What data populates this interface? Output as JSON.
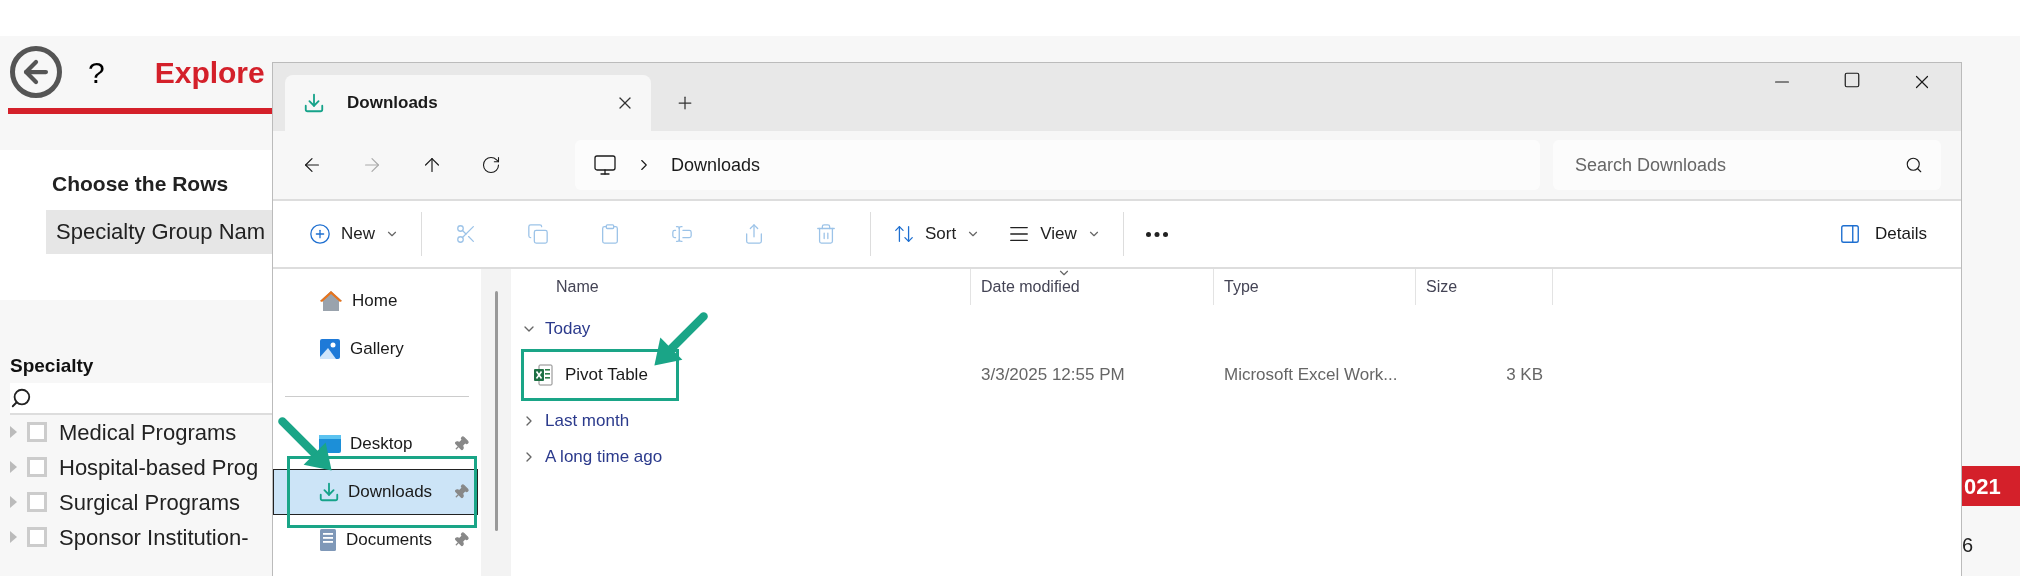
{
  "page": {
    "title": "Explore",
    "help": "?",
    "rows_heading": "Choose the Rows",
    "rows_field": "Specialty Group Nam",
    "filter_heading": "Specialty",
    "tree": [
      {
        "label": "Medical Programs",
        "checked": false
      },
      {
        "label": "Hospital-based Prog",
        "checked": false
      },
      {
        "label": "Surgical Programs",
        "checked": false
      },
      {
        "label": "Sponsor Institution-",
        "checked": false
      }
    ],
    "badge": "021",
    "footer_text": "6"
  },
  "explorer": {
    "tab": {
      "title": "Downloads",
      "selected": true
    },
    "breadcrumb": "Downloads",
    "search": {
      "placeholder": "Search Downloads"
    },
    "toolbar": [
      {
        "kind": "new",
        "label": "New",
        "disabled": false
      },
      {
        "kind": "cut",
        "disabled": true
      },
      {
        "kind": "copy",
        "disabled": true
      },
      {
        "kind": "paste",
        "disabled": true
      },
      {
        "kind": "rename",
        "disabled": true
      },
      {
        "kind": "share",
        "disabled": true
      },
      {
        "kind": "delete",
        "disabled": true
      },
      {
        "kind": "sort",
        "label": "Sort",
        "disabled": false
      },
      {
        "kind": "view",
        "label": "View",
        "disabled": false
      },
      {
        "kind": "more",
        "disabled": false
      }
    ],
    "details": "Details",
    "nav_top": [
      {
        "kind": "home",
        "label": "Home",
        "selected": false
      },
      {
        "kind": "gallery",
        "label": "Gallery",
        "selected": false
      }
    ],
    "nav_pinned": [
      {
        "kind": "desktop",
        "label": "Desktop",
        "selected": false,
        "annotated": false
      },
      {
        "kind": "downloads",
        "label": "Downloads",
        "selected": true,
        "annotated": true
      },
      {
        "kind": "documents",
        "label": "Documents",
        "selected": false,
        "annotated": false
      }
    ],
    "columns": [
      "Name",
      "Date modified",
      "Type",
      "Size"
    ],
    "groups": [
      {
        "label": "Today",
        "expanded": true,
        "files": [
          {
            "name": "Pivot Table",
            "date": "3/3/2025 12:55 PM",
            "type": "Microsoft Excel Work...",
            "size": "3 KB",
            "annotated": true
          }
        ]
      },
      {
        "label": "Last month",
        "expanded": false
      },
      {
        "label": "A long time ago",
        "expanded": false
      }
    ]
  }
}
